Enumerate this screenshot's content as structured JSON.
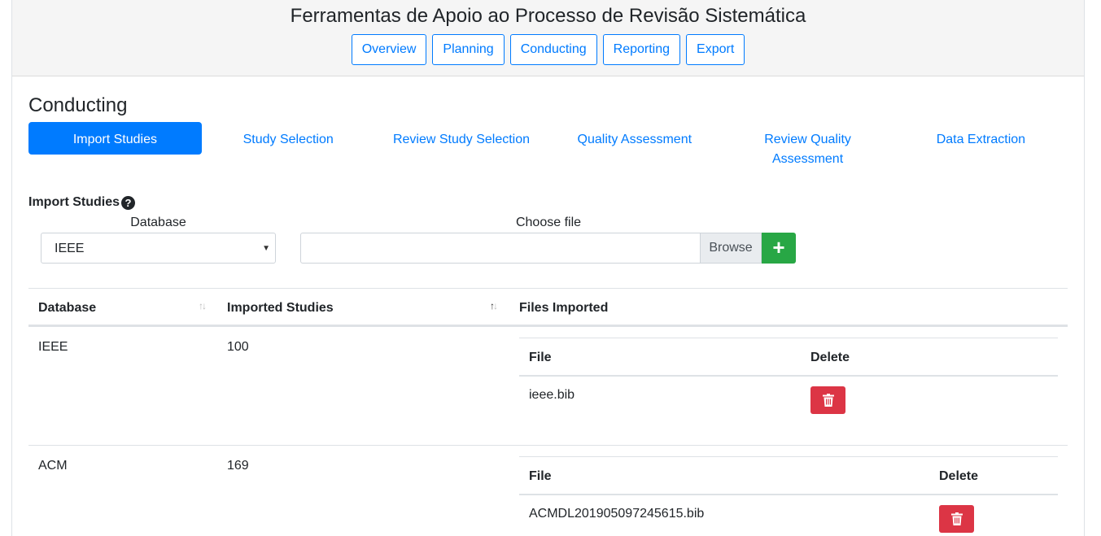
{
  "app": {
    "title": "Ferramentas de Apoio ao Processo de Revisão Sistemática"
  },
  "topnav": {
    "items": [
      "Overview",
      "Planning",
      "Conducting",
      "Reporting",
      "Export"
    ]
  },
  "page": {
    "section_title": "Conducting"
  },
  "subnav": {
    "tabs": [
      "Import Studies",
      "Study Selection",
      "Review Study Selection",
      "Quality Assessment",
      "Review Quality Assessment",
      "Data Extraction"
    ],
    "active": "Import Studies"
  },
  "import": {
    "label": "Import Studies",
    "help_icon": "question-circle-icon",
    "database_label": "Database",
    "database_value": "IEEE",
    "file_label": "Choose file",
    "browse_label": "Browse",
    "add_icon": "plus-icon"
  },
  "table": {
    "headers": [
      "Database",
      "Imported Studies",
      "Files Imported"
    ],
    "inner_headers": [
      "File",
      "Delete"
    ],
    "rows": [
      {
        "database": "IEEE",
        "imported": "100",
        "files": [
          "ieee.bib"
        ]
      },
      {
        "database": "ACM",
        "imported": "169",
        "files": [
          "ACMDL201905097245615.bib"
        ]
      }
    ]
  },
  "colors": {
    "primary": "#007bff",
    "success": "#28a745",
    "danger": "#dc3545",
    "header_bg": "#f5f5f5"
  }
}
